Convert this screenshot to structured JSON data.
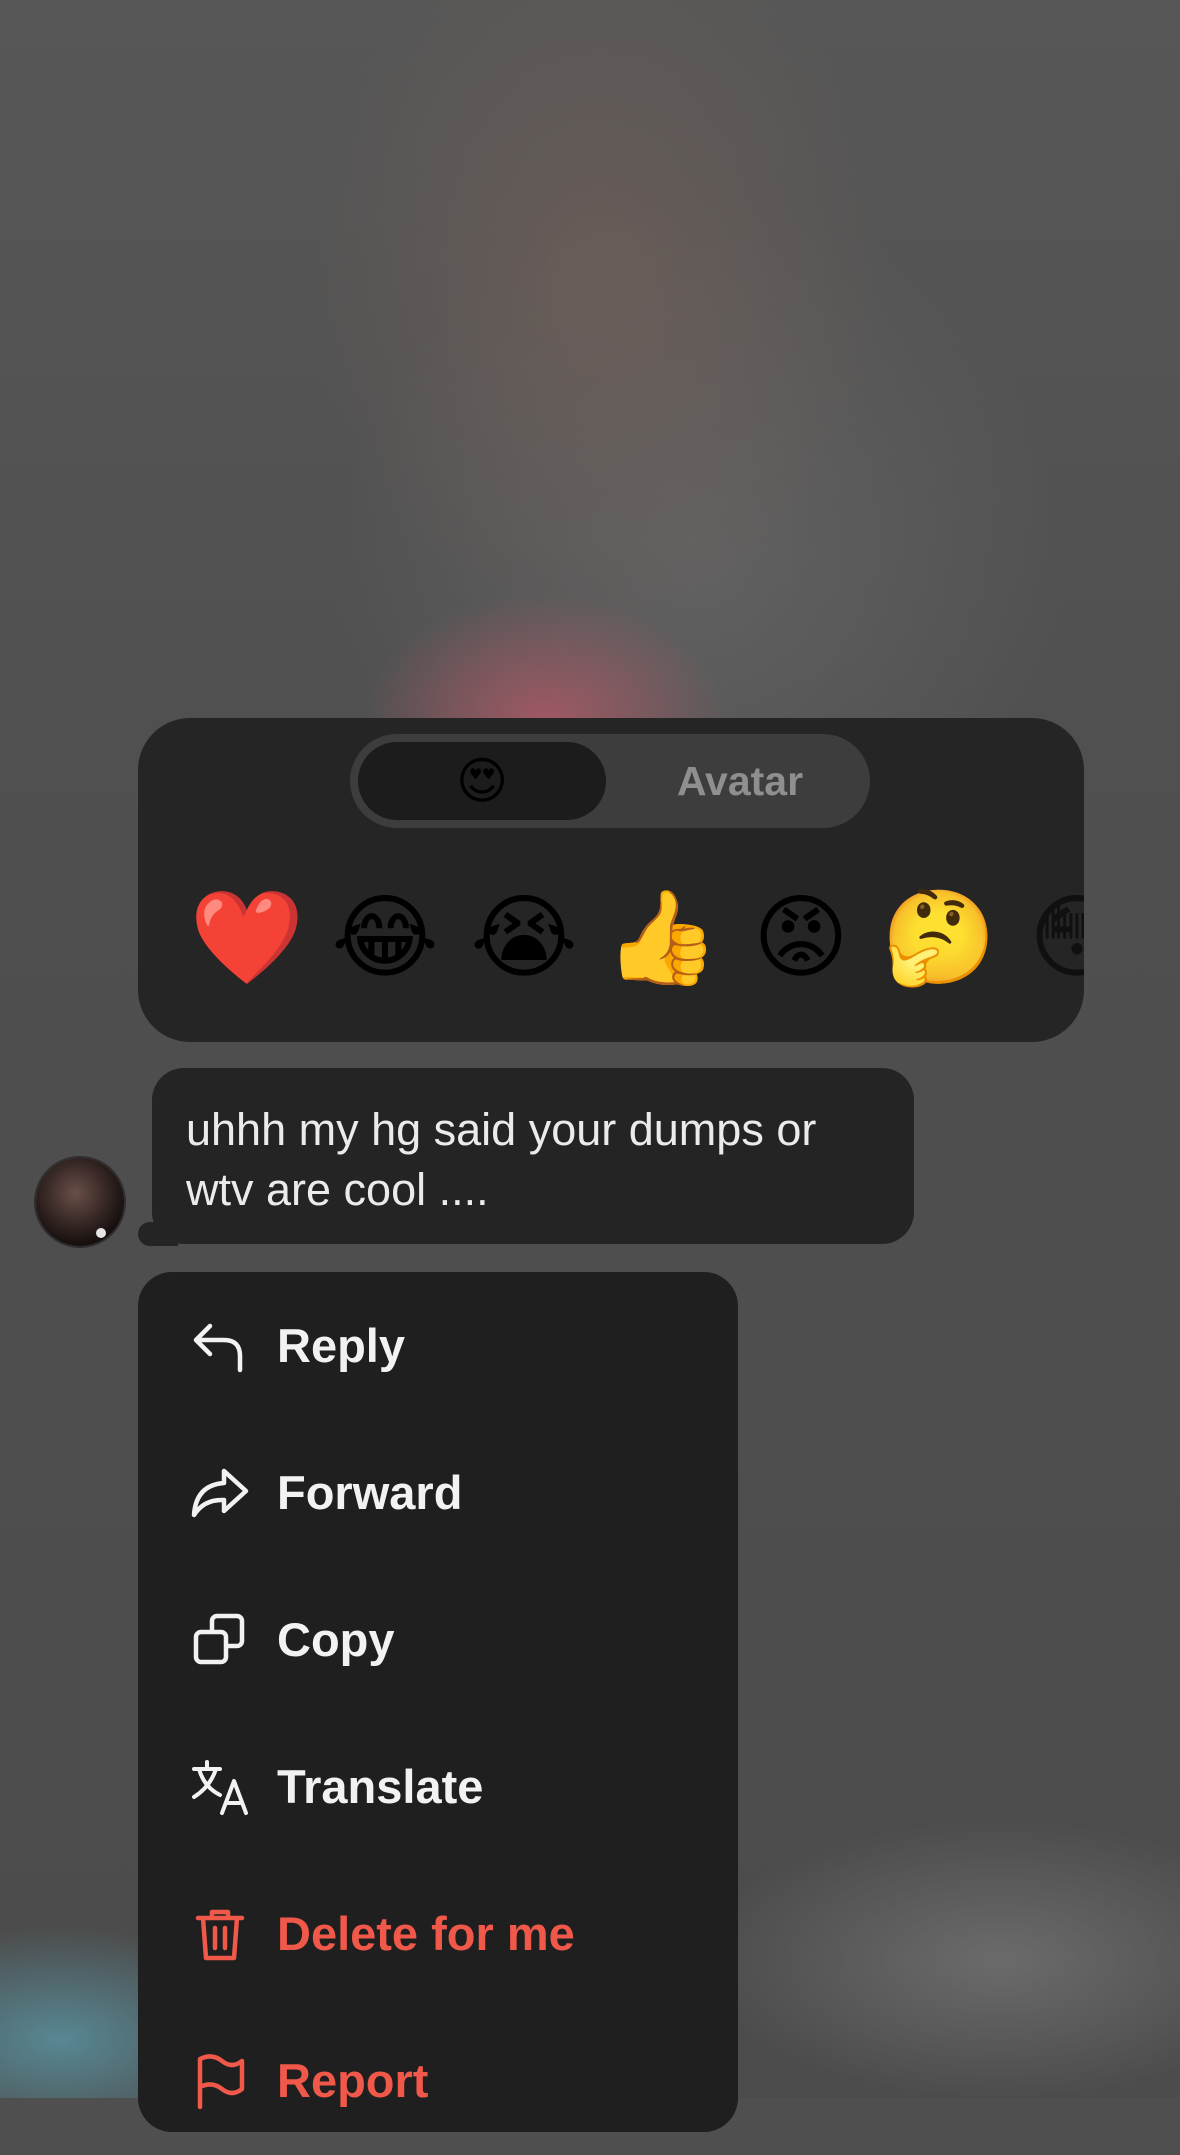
{
  "reaction_picker": {
    "tabs": {
      "emoji_tab": "😍",
      "avatar_tab": "Avatar"
    },
    "emojis": [
      "❤️",
      "😂",
      "😭",
      "👍",
      "😡",
      "🤔",
      "😳"
    ]
  },
  "message": {
    "text_line1": "uhhh my hg said your dumps or",
    "text_line2": "wtv are cool ...."
  },
  "context_menu": {
    "items": [
      {
        "label": "Reply",
        "icon": "reply-icon"
      },
      {
        "label": "Forward",
        "icon": "forward-icon"
      },
      {
        "label": "Copy",
        "icon": "copy-icon"
      },
      {
        "label": "Translate",
        "icon": "translate-icon"
      },
      {
        "label": "Delete for me",
        "icon": "trash-icon"
      },
      {
        "label": "Report",
        "icon": "flag-icon"
      }
    ]
  },
  "colors": {
    "danger": "#f0584a",
    "panel": "#252525",
    "menu": "#1f1f1f"
  }
}
